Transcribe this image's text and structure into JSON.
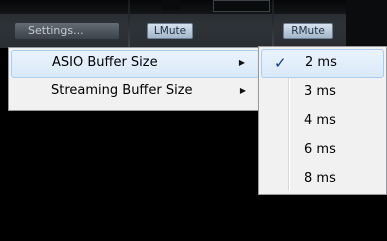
{
  "toolbar": {
    "settings_label": "Settings...",
    "lmute_label": "LMute",
    "rmute_label": "RMute"
  },
  "settings_menu": {
    "items": [
      {
        "label": "ASIO Buffer Size",
        "submenu_icon": "submenu-arrow-icon",
        "highlighted": true
      },
      {
        "label": "Streaming Buffer Size",
        "submenu_icon": "submenu-arrow-icon",
        "highlighted": false
      }
    ],
    "arrow_glyph": "▶"
  },
  "asio_buffer_submenu": {
    "check_glyph": "✓",
    "selected": "2 ms",
    "options": [
      {
        "label": "2 ms",
        "checked": true
      },
      {
        "label": "3 ms",
        "checked": false
      },
      {
        "label": "4 ms",
        "checked": false
      },
      {
        "label": "6 ms",
        "checked": false
      },
      {
        "label": "8 ms",
        "checked": false
      }
    ]
  },
  "colors": {
    "menu_bg": "#f1f1f1",
    "highlight": "#d9e9f9",
    "highlight_border": "#a9cdf1",
    "check": "#0f3b78",
    "app_bg": "#000000"
  }
}
